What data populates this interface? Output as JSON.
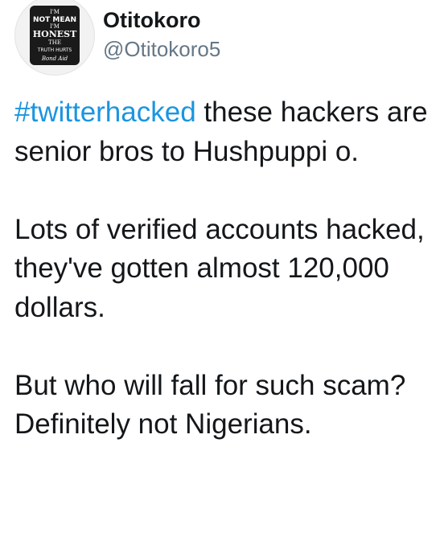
{
  "tweet": {
    "author": {
      "display_name": "Otitokoro",
      "handle": "@Otitokoro5",
      "avatar_text": {
        "line1": "I'M",
        "line2": "NOT MEAN",
        "line3": "I'M",
        "line4": "HONEST",
        "line5": "THE",
        "line6": "TRUTH HURTS",
        "line7": "Bond Aid"
      }
    },
    "hashtag": "#twitterhacked",
    "paragraphs": [
      " these hackers are senior bros to Hushpuppi o.",
      "Lots of verified accounts hacked, they've gotten almost 120,000 dollars.",
      "But who will fall for such scam? Definitely not Nigerians."
    ],
    "colors": {
      "link": "#1b95e0",
      "text": "#14171a",
      "secondary": "#657786"
    }
  }
}
